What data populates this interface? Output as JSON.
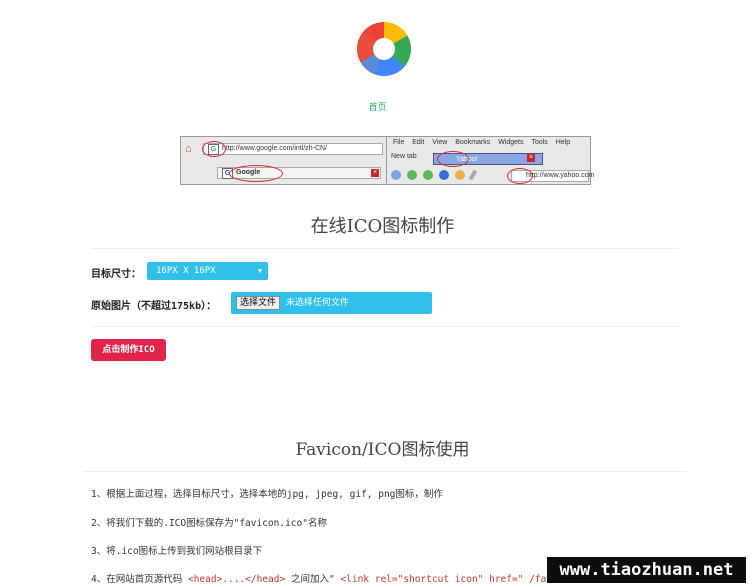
{
  "nav": {
    "home_label": "首页"
  },
  "banner": {
    "address_top": "http://www.google.com/intl/zh-CN/",
    "address_bottom": "Google",
    "menu": [
      "File",
      "Edit",
      "View",
      "Bookmarks",
      "Widgets",
      "Tools",
      "Help"
    ],
    "tab_new": "New tab",
    "tab_yahoo": "Yahoo!",
    "address_yahoo": "http://www.yahoo.com"
  },
  "maker": {
    "title": "在线ICO图标制作",
    "size_label": "目标尺寸：",
    "size_value": "16PX  X  16PX",
    "image_label": "原始图片（不超过175kb）：",
    "file_button": "选择文件",
    "file_status": "未选择任何文件",
    "make_button": "点击制作ICO"
  },
  "usage": {
    "title": "Favicon/ICO图标使用",
    "step1": "1、根据上面过程，选择目标尺寸，选择本地的jpg, jpeg, gif, png图标，制作",
    "step2": "2、将我们下载的.ICO图标保存为\"favicon.ico\"名称",
    "step3": "3、将.ico图标上传到我们网站根目录下",
    "step4_prefix": "4、在网站首页源代码",
    "step4_code1": "<head>....</head>",
    "step4_mid": "之间加入\"",
    "step4_code2": "<link rel=\"shortcut icon\" href=\" /favic"
  },
  "watermark": "www.tiaozhuan.net",
  "colors": {
    "accent_blue": "#2ec0ea",
    "button_red": "#e0244a",
    "home_green": "#27ae60"
  }
}
